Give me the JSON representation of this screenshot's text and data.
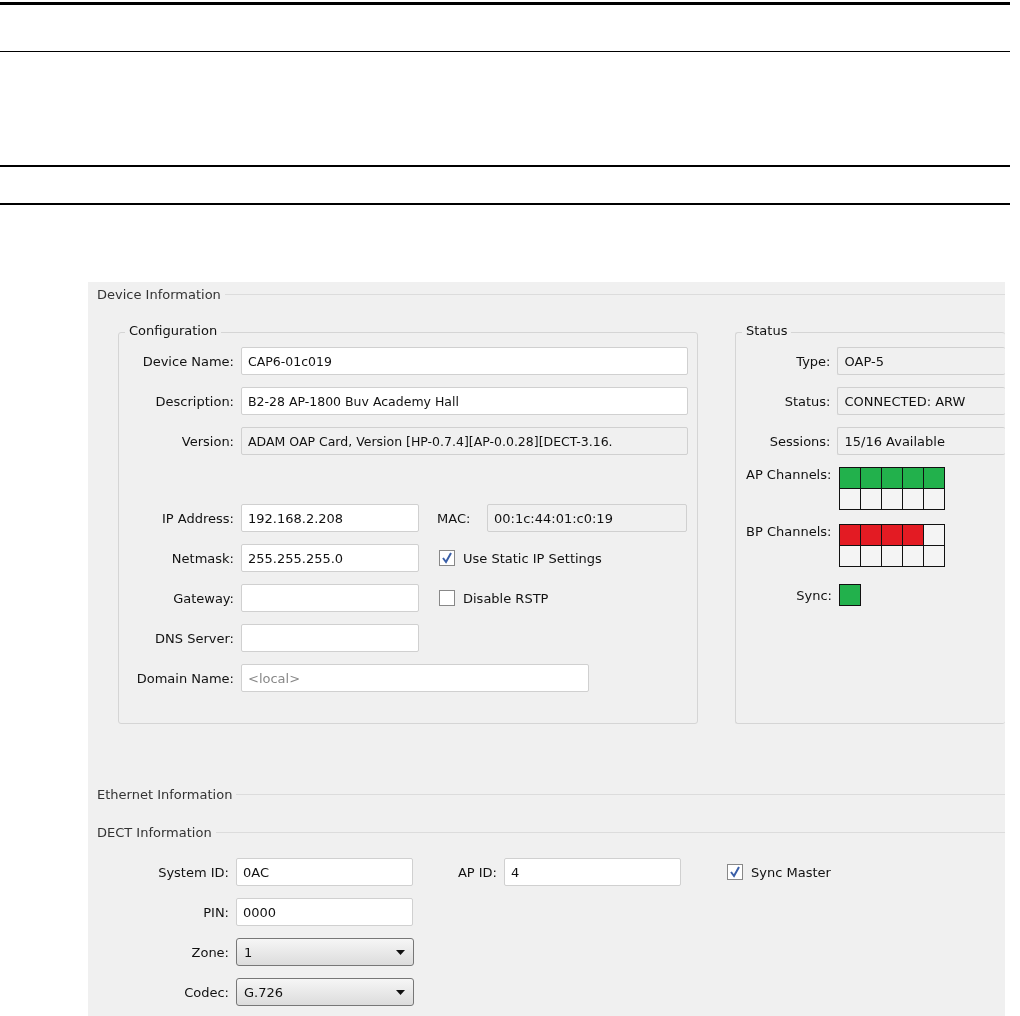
{
  "device_information": {
    "title": "Device Information",
    "configuration": {
      "title": "Configuration",
      "fields": [
        {
          "label": "Device Name:",
          "value": "CAP6-01c019",
          "kind": "text"
        },
        {
          "label": "Description:",
          "value": "B2-28 AP-1800 Buv Academy Hall",
          "kind": "text"
        },
        {
          "label": "Version:",
          "value": "ADAM OAP Card, Version [HP-0.7.4][AP-0.0.28][DECT-3.16.",
          "kind": "readonly"
        }
      ],
      "network": [
        {
          "label": "IP Address:",
          "value": "192.168.2.208"
        },
        {
          "label": "Netmask:",
          "value": "255.255.255.0"
        },
        {
          "label": "Gateway:"
        },
        {
          "label": "DNS Server:"
        }
      ],
      "mac": {
        "label": "MAC:",
        "value": "00:1c:44:01:c0:19"
      },
      "checkboxes": [
        {
          "label": "Use Static IP Settings",
          "checked": true
        },
        {
          "label": "Disable RSTP",
          "checked": false
        }
      ],
      "domain": {
        "label": "Domain Name:",
        "placeholder": "<local>"
      }
    },
    "status": {
      "title": "Status",
      "fields": [
        {
          "label": "Type:",
          "value": "OAP-5"
        },
        {
          "label": "Status:",
          "value": "CONNECTED: ARW"
        },
        {
          "label": "Sessions:",
          "value": "15/16 Available"
        }
      ],
      "channel_groups": [
        {
          "label": "AP Channels:",
          "color": "#22b14c",
          "rows": [
            [
              {
                "on": true
              },
              {
                "on": true
              },
              {
                "on": true
              },
              {
                "on": true
              },
              {
                "on": true
              }
            ],
            [
              {
                "on": false
              },
              {
                "on": false
              },
              {
                "on": false
              },
              {
                "on": false
              },
              {
                "on": false
              }
            ]
          ]
        },
        {
          "label": "BP Channels:",
          "color": "#e31b23",
          "rows": [
            [
              {
                "on": true
              },
              {
                "on": true
              },
              {
                "on": true
              },
              {
                "on": true
              },
              {
                "on": false
              }
            ],
            [
              {
                "on": false
              },
              {
                "on": false
              },
              {
                "on": false
              },
              {
                "on": false
              },
              {
                "on": false
              }
            ]
          ]
        }
      ],
      "sync": {
        "label": "Sync:",
        "on": true,
        "color": "#22b14c"
      }
    }
  },
  "ethernet_information": {
    "title": "Ethernet Information"
  },
  "dect_information": {
    "title": "DECT Information",
    "system_id": {
      "label": "System ID:",
      "value": "0AC"
    },
    "ap_id": {
      "label": "AP ID:",
      "value": "4"
    },
    "sync_master": {
      "label": "Sync Master",
      "checked": true
    },
    "pin": {
      "label": "PIN:",
      "value": "0000"
    },
    "selects": [
      {
        "label": "Zone:",
        "value": "1"
      },
      {
        "label": "Codec:",
        "value": "G.726"
      }
    ]
  }
}
